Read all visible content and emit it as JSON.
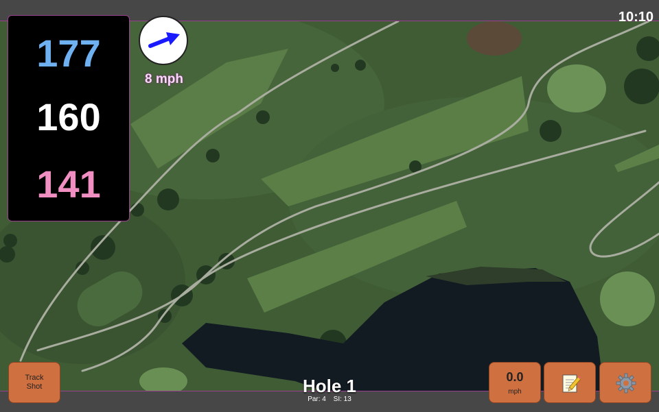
{
  "status": {
    "time": "10:10"
  },
  "distances": {
    "back": "177",
    "middle": "160",
    "front": "141"
  },
  "wind": {
    "speed": "8 mph",
    "direction_icon": "arrow-icon"
  },
  "hole": {
    "title": "Hole 1",
    "par": "Par: 4",
    "stroke_index": "SI: 13"
  },
  "buttons": {
    "track_shot_line1": "Track",
    "track_shot_line2": "Shot",
    "speed_value": "0.0",
    "speed_unit": "mph",
    "notes_icon": "notepad-icon",
    "settings_icon": "gear-icon"
  },
  "colors": {
    "accent_border": "#9a3f8f",
    "button": "#cf7040",
    "back_distance": "#6fb1f0",
    "front_distance": "#f28fc2"
  }
}
